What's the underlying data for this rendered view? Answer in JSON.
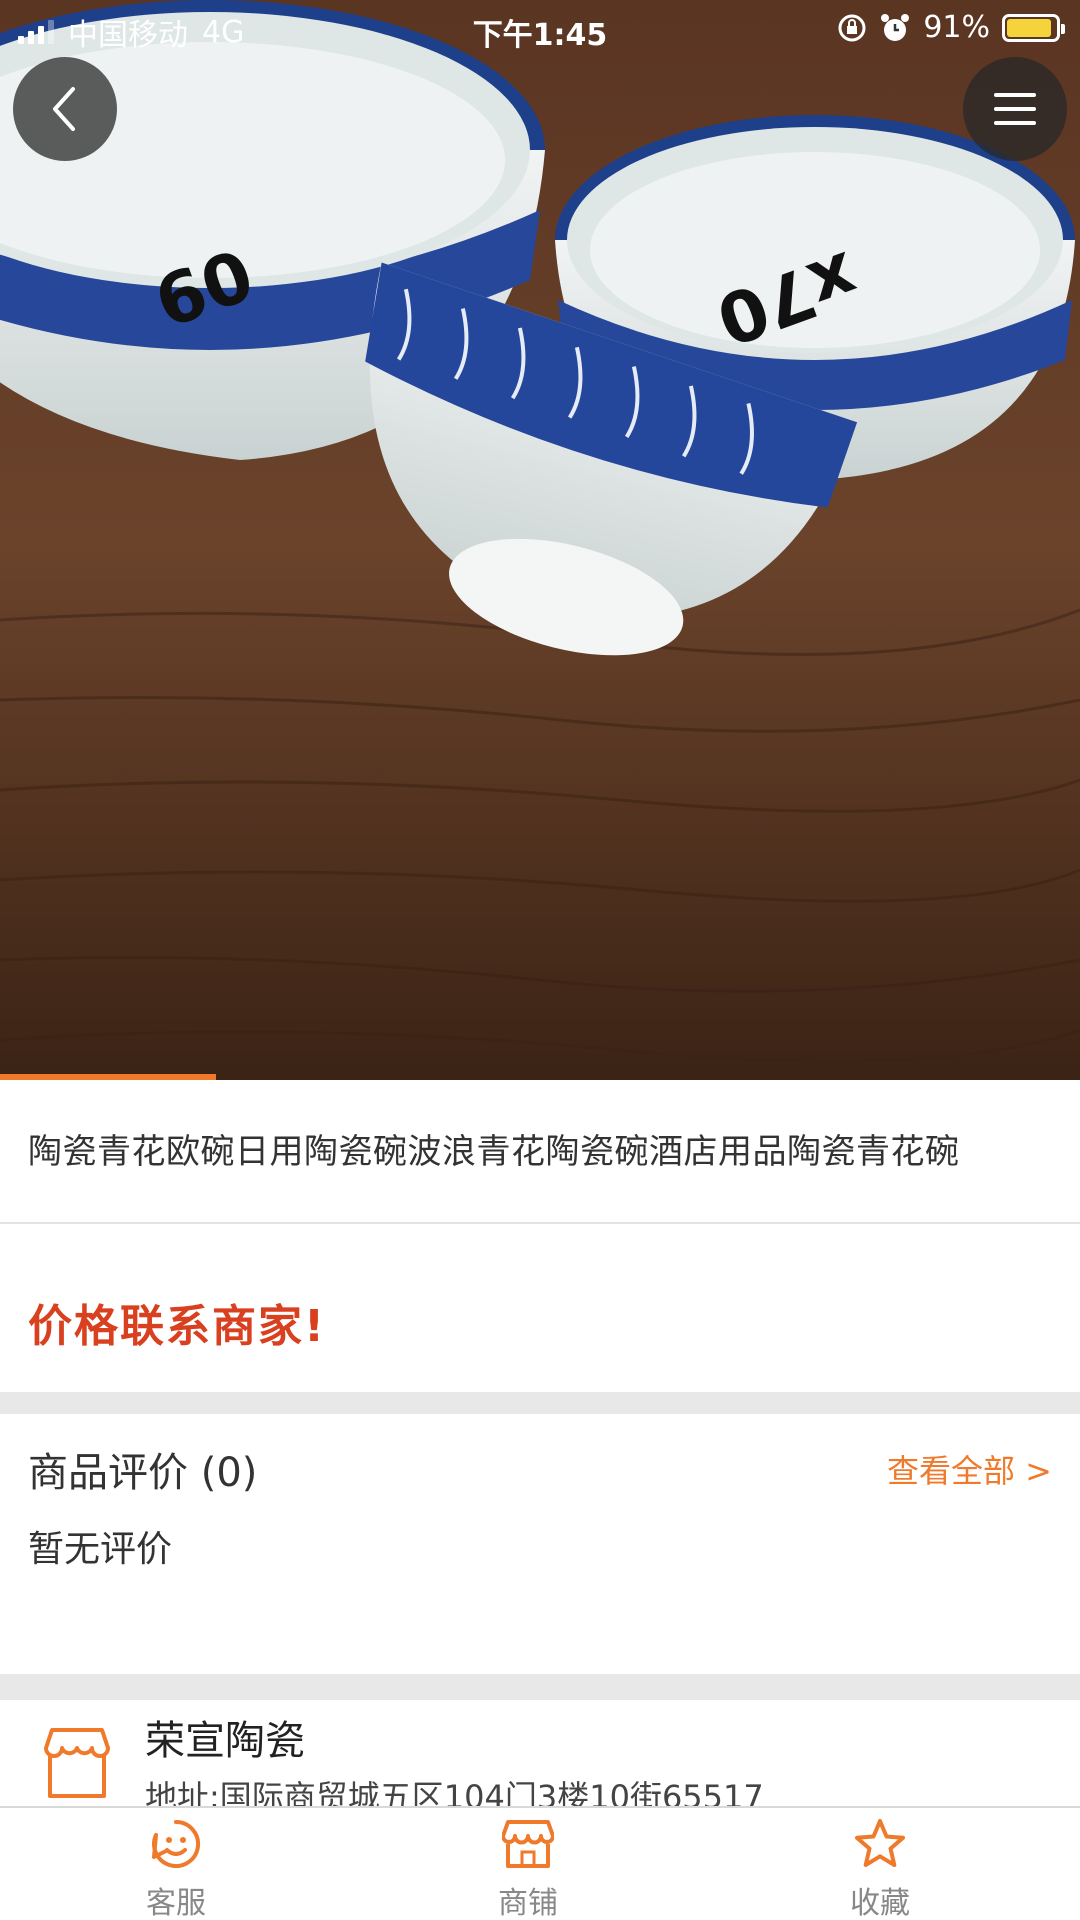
{
  "status_bar": {
    "carrier": "中国移动",
    "network": "4G",
    "time": "下午1:45",
    "battery": "91%",
    "battery_level": 0.91,
    "icons": [
      "signal-icon",
      "rotation-lock-icon",
      "alarm-icon",
      "battery-icon"
    ]
  },
  "nav": {
    "back_icon": "chevron-left-icon",
    "menu_icon": "hamburger-menu-icon"
  },
  "product": {
    "title": "陶瓷青花欧碗日用陶瓷碗波浪青花陶瓷碗酒店用品陶瓷青花碗",
    "price_text": "价格联系商家!",
    "image_markings": [
      "09",
      "x70"
    ]
  },
  "reviews": {
    "title": "商品评价 (0)",
    "view_all": "查看全部 >",
    "empty_text": "暂无评价"
  },
  "shop": {
    "name": "荣宣陶瓷",
    "address": "地址:国际商贸城五区104门3楼10街65517",
    "icon": "storefront-icon"
  },
  "tabbar": {
    "items": [
      {
        "label": "客服",
        "icon": "smiley-service-icon"
      },
      {
        "label": "商铺",
        "icon": "store-icon"
      },
      {
        "label": "收藏",
        "icon": "star-icon"
      }
    ]
  },
  "colors": {
    "accent": "#ef7a2b",
    "price": "#d8401f",
    "divider": "#e8e8e8"
  }
}
